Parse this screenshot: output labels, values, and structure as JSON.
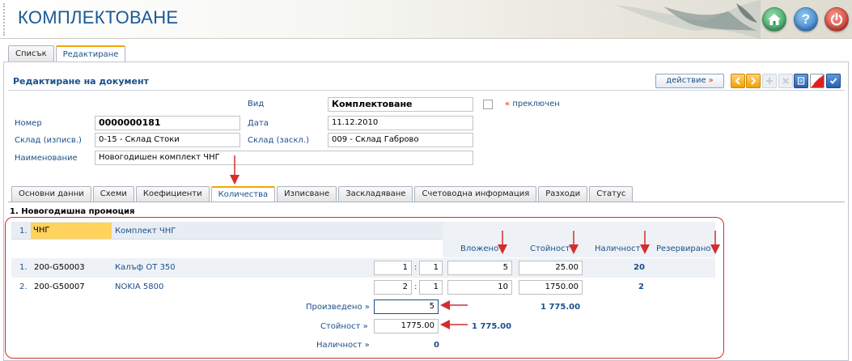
{
  "app": {
    "title": "КОМПЛЕКТОВАНЕ"
  },
  "header_buttons": {
    "home": "home-icon",
    "help": "?",
    "power": "power-icon"
  },
  "main_tabs": [
    {
      "label": "Списък"
    },
    {
      "label": "Редактиране"
    }
  ],
  "document": {
    "title": "Редактиране на документ",
    "action_label": "действие",
    "action_arrow": "»"
  },
  "form": {
    "vid_label": "Вид",
    "vid_value": "Комплектоване",
    "switched_prefix": "«",
    "switched_label": "преключен",
    "nomer_label": "Номер",
    "nomer_value": "0000000181",
    "data_label": "Дата",
    "data_value": "11.12.2010",
    "sklad_out_label": "Склад (изписв.)",
    "sklad_out_value": "0-15 - Склад Стоки",
    "sklad_in_label": "Склад (заскл.)",
    "sklad_in_value": "009 - Склад Габрово",
    "name_label": "Наименование",
    "name_value": "Новогодишен комплект ЧНГ"
  },
  "sub_tabs": [
    {
      "label": "Основни данни"
    },
    {
      "label": "Схеми"
    },
    {
      "label": "Коефициенти"
    },
    {
      "label": "Количества"
    },
    {
      "label": "Изписване"
    },
    {
      "label": "Заскладяване"
    },
    {
      "label": "Счетоводна информация"
    },
    {
      "label": "Разходи"
    },
    {
      "label": "Статус"
    }
  ],
  "section": {
    "title": "1. Новогодишна промоция",
    "kit": {
      "index": "1.",
      "code": "ЧНГ",
      "name": "Комплект ЧНГ"
    },
    "columns": {
      "vlojeno": "Вложено",
      "stoinost": "Стойност",
      "nalichnost": "Наличност",
      "rezervirano": "Резервирано"
    },
    "rows": [
      {
        "index": "1.",
        "code": "200-G50003",
        "name": "Калъф OT 350",
        "q1": "1",
        "q2": "1",
        "vlojeno": "5",
        "stoinost": "25.00",
        "nalichnost": "20"
      },
      {
        "index": "2.",
        "code": "200-G50007",
        "name": "NOKIA 5800",
        "q1": "2",
        "q2": "1",
        "vlojeno": "10",
        "stoinost": "1750.00",
        "nalichnost": "2"
      }
    ],
    "totals": {
      "produced_label": "Произведено »",
      "produced_value": "5",
      "produced_sum": "1 775.00",
      "value_label": "Стойност »",
      "value_value": "1775.00",
      "value_sum": "1 775.00",
      "avail_label": "Наличност »",
      "avail_value": "0"
    }
  },
  "colors": {
    "accent": "#1a4f8a",
    "highlight": "#ffd35c",
    "annotation": "#d42d2d",
    "tab_active": "#f0a800"
  }
}
